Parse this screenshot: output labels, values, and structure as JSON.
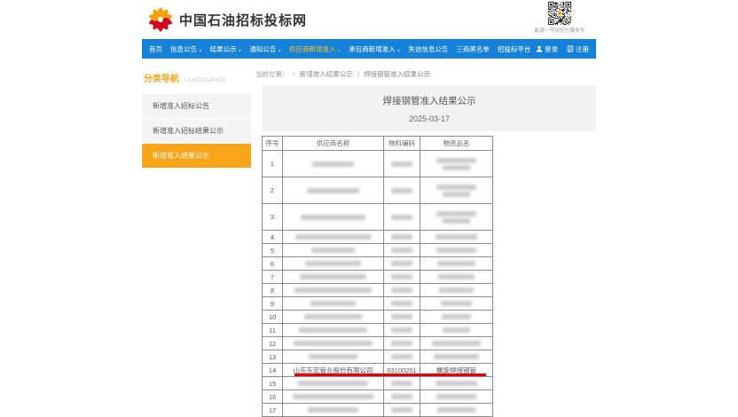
{
  "header": {
    "site_title": "中国石油招标投标网",
    "qr_caption": "能源一号网官方服务号"
  },
  "nav": {
    "caret": "∨",
    "items": [
      {
        "label": "首页",
        "dropdown": false,
        "highlight": false
      },
      {
        "label": "信息公告",
        "dropdown": true,
        "highlight": false
      },
      {
        "label": "结果公示",
        "dropdown": true,
        "highlight": false
      },
      {
        "label": "通知公告",
        "dropdown": true,
        "highlight": false
      },
      {
        "label": "供应商新增准入",
        "dropdown": true,
        "highlight": true
      },
      {
        "label": "承包商新增准入",
        "dropdown": true,
        "highlight": false
      },
      {
        "label": "失信信息公告",
        "dropdown": false,
        "highlight": false
      },
      {
        "label": "三商黑名单",
        "dropdown": false,
        "highlight": false
      },
      {
        "label": "招投标平台",
        "dropdown": false,
        "highlight": false
      }
    ],
    "login_label": "登录",
    "register_label": "注册"
  },
  "sidebar": {
    "title": "分类导航",
    "title_en": "/ CATEGORIES",
    "items": [
      {
        "label": "新增准入招标公告",
        "active": false
      },
      {
        "label": "新增准入招标结果公示",
        "active": false
      },
      {
        "label": "新增准入结果公示",
        "active": true
      }
    ]
  },
  "breadcrumb": {
    "prefix": "当前位置：",
    "separator": "/",
    "items": [
      "新增准入结果公示",
      "焊接钢管准入结果公示"
    ]
  },
  "article": {
    "title": "焊接钢管准入结果公示",
    "date": "2025-03-17"
  },
  "table": {
    "headers": [
      "序号",
      "供应商名称",
      "物料编码",
      "物资品名"
    ],
    "rows": [
      {
        "no": "1",
        "tall": true,
        "blurred": true,
        "supplier": "",
        "code": "",
        "item": ""
      },
      {
        "no": "2",
        "tall": true,
        "blurred": true,
        "supplier": "",
        "code": "",
        "item": ""
      },
      {
        "no": "3",
        "tall": true,
        "blurred": true,
        "supplier": "",
        "code": "",
        "item": ""
      },
      {
        "no": "4",
        "tall": false,
        "blurred": true,
        "supplier": "",
        "code": "",
        "item": ""
      },
      {
        "no": "5",
        "tall": false,
        "blurred": true,
        "supplier": "",
        "code": "",
        "item": ""
      },
      {
        "no": "6",
        "tall": false,
        "blurred": true,
        "supplier": "",
        "code": "",
        "item": ""
      },
      {
        "no": "7",
        "tall": false,
        "blurred": true,
        "supplier": "",
        "code": "",
        "item": ""
      },
      {
        "no": "8",
        "tall": false,
        "blurred": true,
        "supplier": "",
        "code": "",
        "item": ""
      },
      {
        "no": "9",
        "tall": false,
        "blurred": true,
        "supplier": "",
        "code": "",
        "item": ""
      },
      {
        "no": "10",
        "tall": false,
        "blurred": true,
        "supplier": "",
        "code": "",
        "item": ""
      },
      {
        "no": "11",
        "tall": false,
        "blurred": true,
        "supplier": "",
        "code": "",
        "item": ""
      },
      {
        "no": "12",
        "tall": false,
        "blurred": true,
        "supplier": "",
        "code": "",
        "item": ""
      },
      {
        "no": "13",
        "tall": false,
        "blurred": true,
        "supplier": "",
        "code": "",
        "item": ""
      },
      {
        "no": "14",
        "tall": false,
        "blurred": false,
        "underlined": true,
        "supplier": "山东东宏管业股份有限公司",
        "code": "03100201",
        "item": "螺旋焊接钢管"
      },
      {
        "no": "15",
        "tall": false,
        "blurred": true,
        "supplier": "",
        "code": "",
        "item": ""
      },
      {
        "no": "16",
        "tall": false,
        "blurred": true,
        "supplier": "",
        "code": "",
        "item": ""
      },
      {
        "no": "17",
        "tall": false,
        "blurred": true,
        "supplier": "",
        "code": "",
        "item": ""
      }
    ]
  },
  "colors": {
    "nav_blue": "#1681d9",
    "brand_orange": "#f9a51a",
    "nav_highlight_yellow": "#ffc31f",
    "underline_red": "#e60000",
    "logo_red": "#d7001d",
    "logo_orange": "#f7a10c"
  }
}
